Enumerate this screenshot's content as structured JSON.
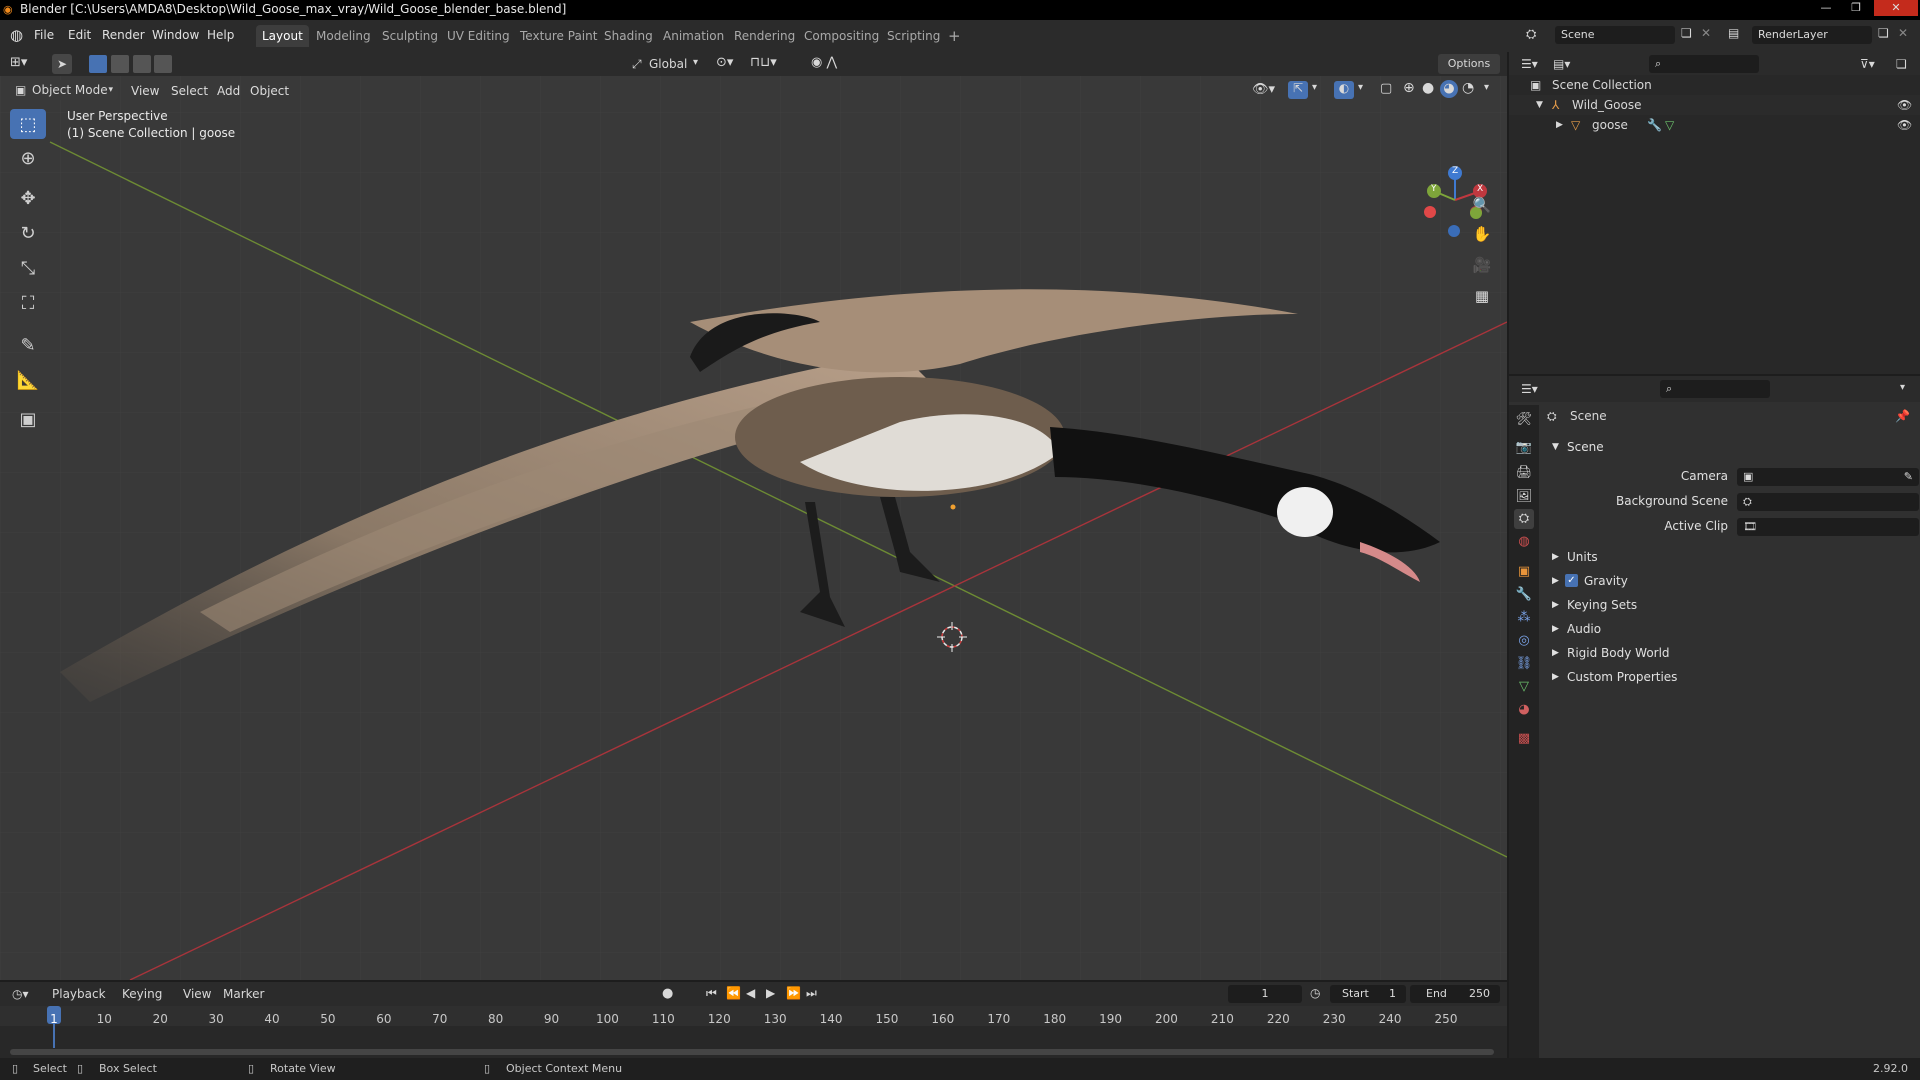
{
  "window": {
    "title": "Blender [C:\\Users\\AMDA8\\Desktop\\Wild_Goose_max_vray/Wild_Goose_blender_base.blend]"
  },
  "menu": [
    "File",
    "Edit",
    "Render",
    "Window",
    "Help"
  ],
  "workspaces": {
    "tabs": [
      "Layout",
      "Modeling",
      "Sculpting",
      "UV Editing",
      "Texture Paint",
      "Shading",
      "Animation",
      "Rendering",
      "Compositing",
      "Scripting"
    ],
    "active": "Layout",
    "add": "+"
  },
  "scene_selector": {
    "scene": "Scene",
    "render_layer": "RenderLayer"
  },
  "viewport": {
    "mode": "Object Mode",
    "menus": [
      "View",
      "Select",
      "Add",
      "Object"
    ],
    "orientation": "Global",
    "options": "Options",
    "overlay_title": "User Perspective",
    "overlay_sub": "(1) Scene Collection | goose",
    "gizmo": {
      "x": "X",
      "y": "Y",
      "z": "Z"
    }
  },
  "outliner": {
    "root": "Scene Collection",
    "items": [
      {
        "name": "Wild_Goose",
        "depth": 1
      },
      {
        "name": "goose",
        "depth": 2
      }
    ]
  },
  "properties": {
    "context": "Scene",
    "section": "Scene",
    "fields": [
      {
        "label": "Camera",
        "value": ""
      },
      {
        "label": "Background Scene",
        "value": ""
      },
      {
        "label": "Active Clip",
        "value": ""
      }
    ],
    "panels": [
      {
        "label": "Units",
        "checkbox": false
      },
      {
        "label": "Gravity",
        "checkbox": true
      },
      {
        "label": "Keying Sets",
        "checkbox": false
      },
      {
        "label": "Audio",
        "checkbox": false
      },
      {
        "label": "Rigid Body World",
        "checkbox": false
      },
      {
        "label": "Custom Properties",
        "checkbox": false
      }
    ]
  },
  "timeline": {
    "menus": [
      "Playback",
      "Keying",
      "View",
      "Marker"
    ],
    "current_frame": "1",
    "start_label": "Start",
    "start": "1",
    "end_label": "End",
    "end": "250",
    "ticks": [
      "1",
      "10",
      "20",
      "30",
      "40",
      "50",
      "60",
      "70",
      "80",
      "90",
      "100",
      "110",
      "120",
      "130",
      "140",
      "150",
      "160",
      "170",
      "180",
      "190",
      "200",
      "210",
      "220",
      "230",
      "240",
      "250"
    ]
  },
  "statusbar": {
    "select": "Select",
    "box_select": "Box Select",
    "rotate_view": "Rotate View",
    "context_menu": "Object Context Menu",
    "version": "2.92.0"
  },
  "colors": {
    "accent": "#4772b3",
    "x_axis": "#c0383f",
    "y_axis": "#7ea53a",
    "z_axis": "#3f7ad1"
  }
}
